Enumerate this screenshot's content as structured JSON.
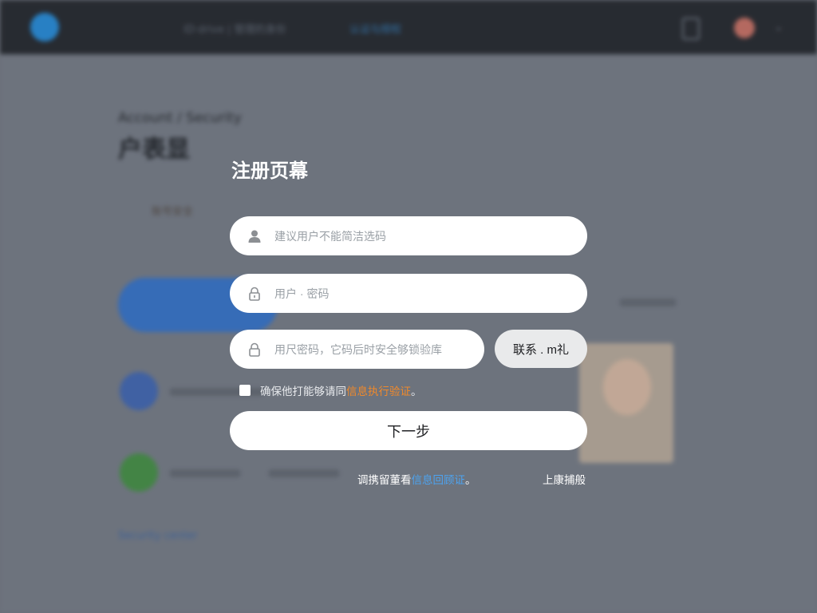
{
  "colors": {
    "accent_link": "#4da3ef",
    "agree_link": "#f0892b",
    "topbar": "#1d2025"
  },
  "background": {
    "top_link": "ID·drive | 管理的身份",
    "top_link_blue": "认证与授权",
    "breadcrumb_sub": "Account / Security",
    "page_title": "户表显",
    "breadcrumb": "账号安全",
    "footer_link": "Security center"
  },
  "form": {
    "title": "注册页幕",
    "username_placeholder": "建议用户不能简洁选码",
    "password_placeholder": "用户 ·  密码",
    "code_placeholder": "用尺密码，它码后时安全够锁验库",
    "side_button": "联系 . m礼",
    "agree_text": "确保他打能够请同",
    "agree_link": "信息执行验证",
    "agree_suffix": "。",
    "next_button": "下一步",
    "footer_left_text": "调携留董看",
    "footer_left_link": "信息回顾证",
    "footer_left_suffix": "。",
    "footer_right": "上康捕般"
  },
  "icons": {
    "username": "user-icon",
    "password": "lock-icon",
    "code": "lock-icon"
  }
}
